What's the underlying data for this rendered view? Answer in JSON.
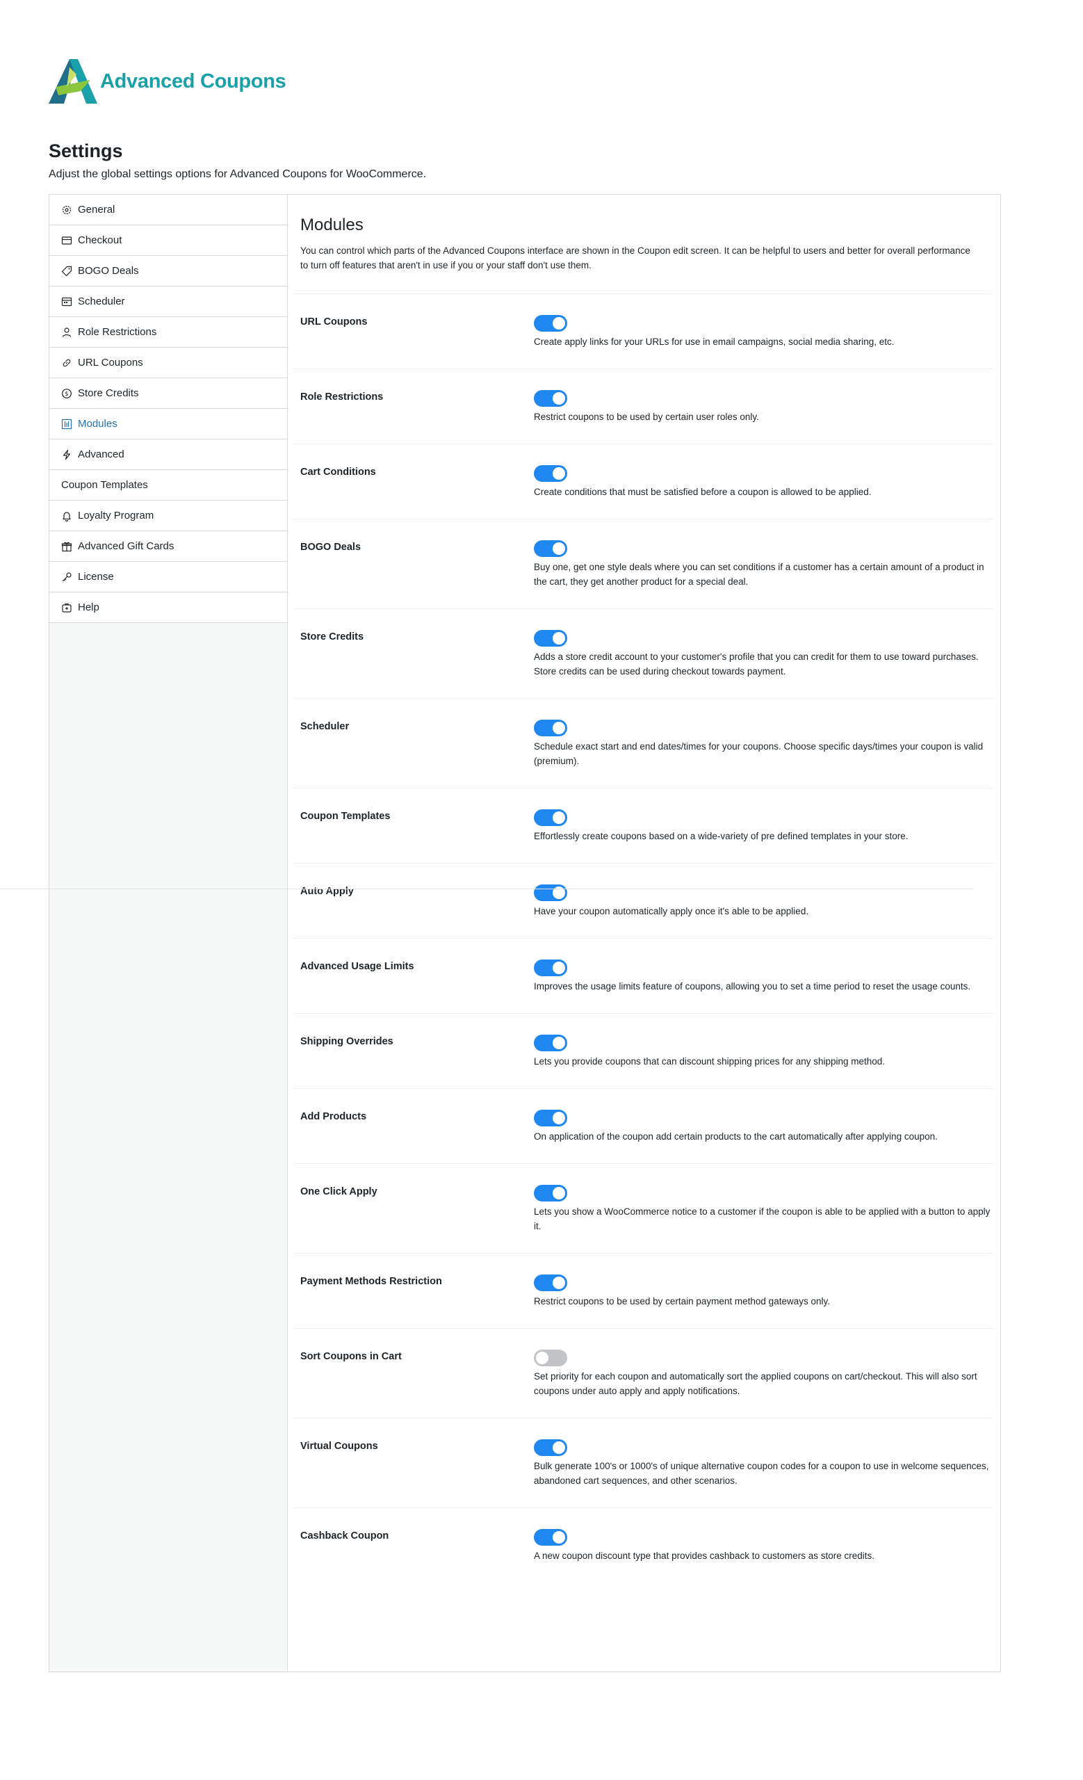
{
  "brand": {
    "name": "Advanced Coupons",
    "color": "#1aa0a8"
  },
  "header": {
    "title": "Settings",
    "description": "Adjust the global settings options for Advanced Coupons for WooCommerce."
  },
  "sidebar": {
    "items": [
      {
        "label": "General",
        "icon": "gear-icon"
      },
      {
        "label": "Checkout",
        "icon": "credit-card-icon"
      },
      {
        "label": "BOGO Deals",
        "icon": "tag-icon"
      },
      {
        "label": "Scheduler",
        "icon": "calendar-icon"
      },
      {
        "label": "Role Restrictions",
        "icon": "user-icon"
      },
      {
        "label": "URL Coupons",
        "icon": "link-icon"
      },
      {
        "label": "Store Credits",
        "icon": "dollar-circle-icon"
      },
      {
        "label": "Modules",
        "icon": "modules-icon",
        "active": true
      },
      {
        "label": "Advanced",
        "icon": "lightning-icon"
      },
      {
        "label": "Coupon Templates",
        "icon": ""
      },
      {
        "label": "Loyalty Program",
        "icon": "bell-icon"
      },
      {
        "label": "Advanced Gift Cards",
        "icon": "gift-icon"
      },
      {
        "label": "License",
        "icon": "key-icon"
      },
      {
        "label": "Help",
        "icon": "help-icon"
      }
    ]
  },
  "main": {
    "title": "Modules",
    "description": "You can control which parts of the Advanced Coupons interface are shown in the Coupon edit screen. It can be helpful to users and better for overall performance to turn off features that aren't in use if you or your staff don't use them.",
    "modules": [
      {
        "name": "URL Coupons",
        "enabled": true,
        "description": "Create apply links for your URLs for use in email campaigns, social media sharing, etc."
      },
      {
        "name": "Role Restrictions",
        "enabled": true,
        "description": "Restrict coupons to be used by certain user roles only."
      },
      {
        "name": "Cart Conditions",
        "enabled": true,
        "description": "Create conditions that must be satisfied before a coupon is allowed to be applied."
      },
      {
        "name": "BOGO Deals",
        "enabled": true,
        "description": "Buy one, get one style deals where you can set conditions if a customer has a certain amount of a product in the cart, they get another product for a special deal."
      },
      {
        "name": "Store Credits",
        "enabled": true,
        "description": "Adds a store credit account to your customer's profile that you can credit for them to use toward purchases. Store credits can be used during checkout towards payment."
      },
      {
        "name": "Scheduler",
        "enabled": true,
        "description": "Schedule exact start and end dates/times for your coupons. Choose specific days/times your coupon is valid (premium)."
      },
      {
        "name": "Coupon Templates",
        "enabled": true,
        "description": "Effortlessly create coupons based on a wide-variety of pre defined templates in your store."
      },
      {
        "name": "Auto Apply",
        "enabled": true,
        "description": "Have your coupon automatically apply once it's able to be applied."
      },
      {
        "name": "Advanced Usage Limits",
        "enabled": true,
        "description": "Improves the usage limits feature of coupons, allowing you to set a time period to reset the usage counts."
      },
      {
        "name": "Shipping Overrides",
        "enabled": true,
        "description": "Lets you provide coupons that can discount shipping prices for any shipping method."
      },
      {
        "name": "Add Products",
        "enabled": true,
        "description": "On application of the coupon add certain products to the cart automatically after applying coupon."
      },
      {
        "name": "One Click Apply",
        "enabled": true,
        "description": "Lets you show a WooCommerce notice to a customer if the coupon is able to be applied with a button to apply it."
      },
      {
        "name": "Payment Methods Restriction",
        "enabled": true,
        "description": "Restrict coupons to be used by certain payment method gateways only."
      },
      {
        "name": "Sort Coupons in Cart",
        "enabled": false,
        "description": "Set priority for each coupon and automatically sort the applied coupons on cart/checkout. This will also sort coupons under auto apply and apply notifications."
      },
      {
        "name": "Virtual Coupons",
        "enabled": true,
        "description": "Bulk generate 100's or 1000's of unique alternative coupon codes for a coupon to use in welcome sequences, abandoned cart sequences, and other scenarios."
      },
      {
        "name": "Cashback Coupon",
        "enabled": true,
        "description": "A new coupon discount type that provides cashback to customers as store credits."
      }
    ]
  }
}
